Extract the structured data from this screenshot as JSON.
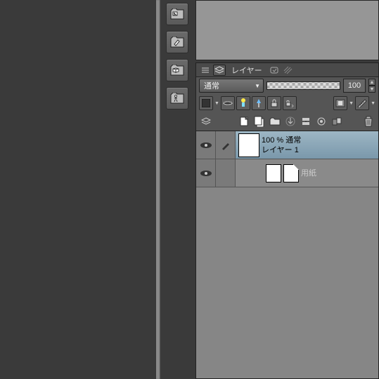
{
  "panel": {
    "title": "レイヤー",
    "blend_mode": "通常",
    "opacity_value": "100"
  },
  "toolShelf": [
    {
      "name": "image-set",
      "icon": "image"
    },
    {
      "name": "material-set",
      "icon": "pencil"
    },
    {
      "name": "3d-set",
      "icon": "cube"
    },
    {
      "name": "pose-set",
      "icon": "figure"
    }
  ],
  "layers": [
    {
      "selected": true,
      "visible": true,
      "editing": true,
      "opacity_line": "100 % 通常",
      "name": "レイヤー 1"
    },
    {
      "selected": false,
      "visible": true,
      "editing": false,
      "opacity_line": "",
      "name": "用紙"
    }
  ],
  "icons": {
    "lock": "lock",
    "ruler": "ruler",
    "fx": "fx"
  }
}
